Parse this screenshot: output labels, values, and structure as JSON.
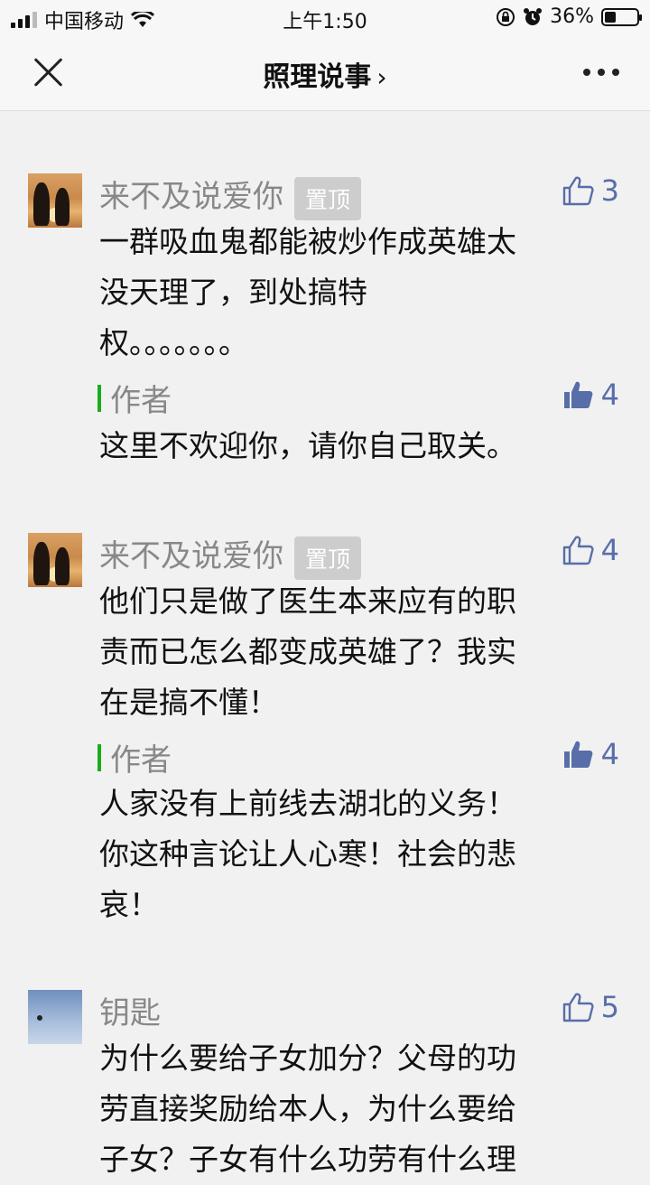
{
  "status_bar": {
    "carrier": "中国移动",
    "time": "上午1:50",
    "battery_percent": "36%",
    "battery_level": 0.36,
    "icons": [
      "signal-icon",
      "wifi-icon",
      "rotation-lock-icon",
      "alarm-icon",
      "battery-icon"
    ]
  },
  "nav": {
    "title": "照理说事",
    "title_chevron": "›",
    "close_icon": "close-icon",
    "more_icon": "more-dots-icon"
  },
  "comments": [
    {
      "username": "来不及说爱你",
      "pinned_label": "置顶",
      "likes": "3",
      "text": "一群吸血鬼都能被炒作成英雄太\n没天理了，到处搞特\n权。。。。。。。",
      "reply": {
        "label": "作者",
        "likes": "4",
        "text": "这里不欢迎你，请你自己取关。"
      }
    },
    {
      "username": "来不及说爱你",
      "pinned_label": "置顶",
      "likes": "4",
      "text": "他们只是做了医生本来应有的职\n责而已怎么都变成英雄了？我实\n在是搞不懂！",
      "reply": {
        "label": "作者",
        "likes": "4",
        "text": "人家没有上前线去湖北的义务！\n你这种言论让人心寒！社会的悲\n哀！"
      }
    },
    {
      "username": "钥匙",
      "likes": "5",
      "text": "为什么要给子女加分？父母的功\n劳直接奖励给本人，为什么要给\n子女？子女有什么功劳有什么理"
    }
  ],
  "colors": {
    "background": "#f1f1f1",
    "like_blue": "#586ea8",
    "author_green": "#1aad19",
    "name_gray": "#888888"
  }
}
